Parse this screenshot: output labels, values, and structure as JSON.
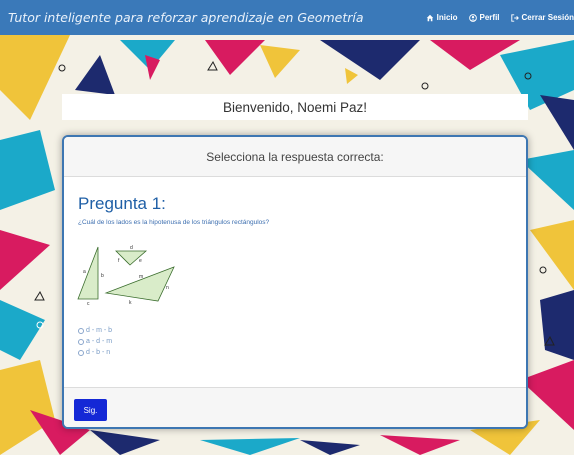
{
  "navbar": {
    "brand": "Tutor inteligente para reforzar aprendizaje en Geometría",
    "links": [
      {
        "label": "Inicio",
        "icon": "home-icon"
      },
      {
        "label": "Perfil",
        "icon": "user-icon"
      },
      {
        "label": "Cerrar Sesión",
        "icon": "sign-out-icon"
      }
    ],
    "color": "#3a79b9"
  },
  "welcome": {
    "text": "Bienvenido, Noemi Paz!"
  },
  "card": {
    "header": "Selecciona la respuesta correcta:",
    "question_title": "Pregunta 1:",
    "question_text": "¿Cuál de los lados es la hipotenusa de los triángulos rectángulos?",
    "figure_labels": [
      "a",
      "b",
      "c",
      "d",
      "e",
      "f",
      "m",
      "n",
      "k"
    ],
    "options": [
      "d - m - b",
      "a - d - m",
      "d - b - n"
    ],
    "next_button": "Sig."
  },
  "colors": {
    "accent": "#3d76b2",
    "button": "#1428d6",
    "question": "#1f5fa6"
  }
}
